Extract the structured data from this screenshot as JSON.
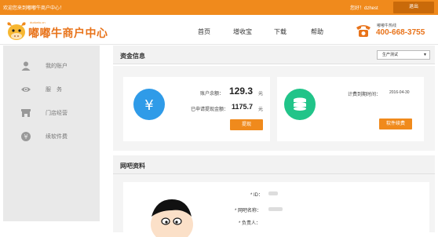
{
  "topbar": {
    "welcome": "欢迎您来到嘟嘟牛商户中心！",
    "user": "您好！dzhest",
    "logout": "退出"
  },
  "brand": {
    "url": "duduniu.cn",
    "name": "嘟嘟牛商户中心"
  },
  "nav": [
    "首页",
    "增收宝",
    "下载",
    "帮助"
  ],
  "hotline": {
    "label": "嘟嘟牛热线",
    "number": "400-668-3755"
  },
  "sidebar": {
    "items": [
      {
        "label": "我的账户",
        "icon": "user-icon"
      },
      {
        "label": "服　务",
        "icon": "eye-icon"
      },
      {
        "label": "门店经营",
        "icon": "store-icon"
      },
      {
        "label": "续软件费",
        "icon": "yen-coin-icon"
      }
    ]
  },
  "funds": {
    "title": "资金信息",
    "select_value": "生产测试",
    "balance_label": "账户余额：",
    "balance_value": "129.3",
    "balance_unit": "元",
    "withdrawn_label": "已申请提现金额：",
    "withdrawn_value": "1175.7",
    "withdrawn_unit": "元",
    "withdraw_button": "提现",
    "expire_label": "计费到期时间：",
    "expire_date": "2016-04-30",
    "renew_button": "软件续费"
  },
  "profile": {
    "title": "网吧资料",
    "id_label": "* ID：",
    "name_label": "* 网吧名称：",
    "owner_label": "* 负责人："
  },
  "colors": {
    "accent": "#f08a1c",
    "blue_circle": "#2f9be8",
    "green_circle": "#21c489"
  }
}
